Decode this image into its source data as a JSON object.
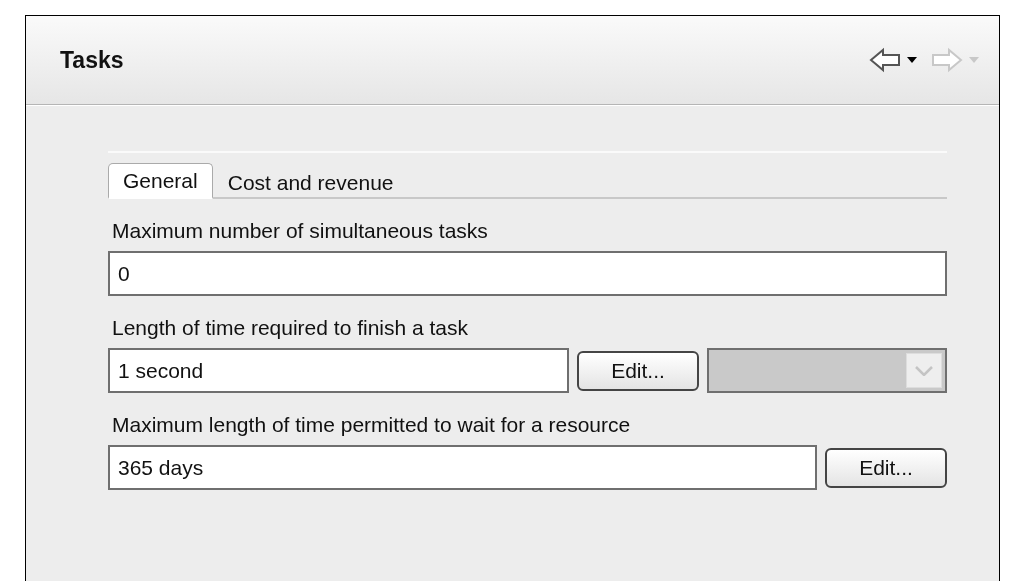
{
  "title": "Tasks",
  "nav": [
    {
      "kind": "back",
      "disabled": false
    },
    {
      "kind": "forward",
      "disabled": true
    }
  ],
  "tabs": [
    {
      "label": "General",
      "selected": true
    },
    {
      "label": "Cost and revenue",
      "selected": false
    }
  ],
  "fields": [
    {
      "label": "Maximum number of simultaneous tasks",
      "value": "0"
    },
    {
      "label": "Length of time required to finish a task",
      "value": "1 second",
      "button": "Edit...",
      "dropdown": {
        "disabled": true
      }
    },
    {
      "label": "Maximum length of time permitted to wait for a resource",
      "value": "365 days",
      "button": "Edit..."
    }
  ]
}
